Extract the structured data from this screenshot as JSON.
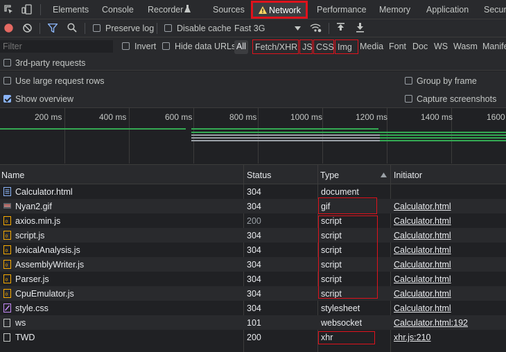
{
  "tabs": {
    "items": [
      {
        "label": "Elements"
      },
      {
        "label": "Console"
      },
      {
        "label": "Recorder"
      },
      {
        "label": "Sources"
      },
      {
        "label": "Network"
      },
      {
        "label": "Performance"
      },
      {
        "label": "Memory"
      },
      {
        "label": "Application"
      },
      {
        "label": "Securi"
      }
    ],
    "active": "Network",
    "network_warning_icon": "warning-triangle-icon",
    "recorder_icon": "flask-icon"
  },
  "toolbar": {
    "preserve_log": "Preserve log",
    "disable_cache": "Disable cache",
    "throttle": "Fast 3G",
    "record_color": "#e46962"
  },
  "filter": {
    "placeholder": "Filter",
    "invert": "Invert",
    "hide_data_urls": "Hide data URLs",
    "types": [
      "All",
      "Fetch/XHR",
      "JS",
      "CSS",
      "Img",
      "Media",
      "Font",
      "Doc",
      "WS",
      "Wasm",
      "Manife"
    ],
    "third_party": "3rd-party requests"
  },
  "options": {
    "large_rows": "Use large request rows",
    "group_by_frame": "Group by frame",
    "show_overview": "Show overview",
    "capture_screenshots": "Capture screenshots"
  },
  "overview": {
    "ticks": [
      "200 ms",
      "400 ms",
      "600 ms",
      "800 ms",
      "1000 ms",
      "1200 ms",
      "1400 ms",
      "1600"
    ],
    "bar_color": "#34a853",
    "bar_color_2": "#9aa0a6"
  },
  "table": {
    "headers": {
      "name": "Name",
      "status": "Status",
      "type": "Type",
      "initiator": "Initiator"
    },
    "rows": [
      {
        "name": "Calculator.html",
        "status": "304",
        "type": "document",
        "initiator": "",
        "icon": "document-icon"
      },
      {
        "name": "Nyan2.gif",
        "status": "304",
        "type": "gif",
        "initiator": "Calculator.html",
        "icon": "image-icon"
      },
      {
        "name": "axios.min.js",
        "status": "200",
        "type": "script",
        "initiator": "Calculator.html",
        "icon": "script-icon"
      },
      {
        "name": "script.js",
        "status": "304",
        "type": "script",
        "initiator": "Calculator.html",
        "icon": "script-icon"
      },
      {
        "name": "lexicalAnalysis.js",
        "status": "304",
        "type": "script",
        "initiator": "Calculator.html",
        "icon": "script-icon"
      },
      {
        "name": "AssemblyWriter.js",
        "status": "304",
        "type": "script",
        "initiator": "Calculator.html",
        "icon": "script-icon"
      },
      {
        "name": "Parser.js",
        "status": "304",
        "type": "script",
        "initiator": "Calculator.html",
        "icon": "script-icon"
      },
      {
        "name": "CpuEmulator.js",
        "status": "304",
        "type": "script",
        "initiator": "Calculator.html",
        "icon": "script-icon"
      },
      {
        "name": "style.css",
        "status": "304",
        "type": "stylesheet",
        "initiator": "Calculator.html",
        "icon": "stylesheet-icon"
      },
      {
        "name": "ws",
        "status": "101",
        "type": "websocket",
        "initiator": "Calculator.html:192",
        "icon": "blank-file-icon"
      },
      {
        "name": "TWD",
        "status": "200",
        "type": "xhr",
        "initiator": "xhr.js:210",
        "icon": "blank-file-icon"
      }
    ]
  }
}
